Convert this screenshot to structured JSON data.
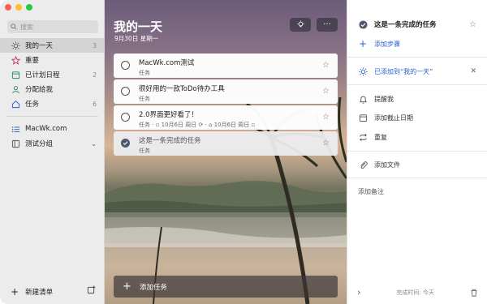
{
  "sidebar": {
    "search_placeholder": "搜索",
    "items": [
      {
        "label": "我的一天",
        "count": "3",
        "icon": "sun-icon",
        "color": "#555555"
      },
      {
        "label": "重要",
        "count": "",
        "icon": "star-icon",
        "color": "#c23a6b"
      },
      {
        "label": "已计划日程",
        "count": "2",
        "icon": "calendar-icon",
        "color": "#1f8a5a"
      },
      {
        "label": "分配给我",
        "count": "",
        "icon": "person-icon",
        "color": "#1f8a5a"
      },
      {
        "label": "任务",
        "count": "6",
        "icon": "home-icon",
        "color": "#2b5fc9"
      }
    ],
    "lists": [
      {
        "label": "MacWk.com",
        "icon": "list-icon"
      },
      {
        "label": "测试分组",
        "icon": "group-icon"
      }
    ],
    "new_list": "新建清单"
  },
  "main": {
    "title": "我的一天",
    "date": "9月30日 星期一",
    "tasks": [
      {
        "title": "MacWk.com测试",
        "sub": "任务",
        "done": false
      },
      {
        "title": "很好用的一款ToDo待办工具",
        "sub": "任务",
        "done": false
      },
      {
        "title": "2.0界面更好看了！",
        "sub": "任务 · ▫ 10月6日 周日 ⟳ · ⌂ 10月6日 周日 ▫",
        "done": false
      },
      {
        "title": "这是一条完成的任务",
        "sub": "任务",
        "done": true
      }
    ],
    "add_task": "添加任务"
  },
  "detail": {
    "task_title": "这是一条完成的任务",
    "add_step": "添加步骤",
    "added_my_day": "已添加到“我的一天”",
    "remind_me": "提醒我",
    "add_due": "添加截止日期",
    "repeat": "重复",
    "add_file": "添加文件",
    "add_note": "添加备注",
    "completed_time": "完成时间: 今天"
  },
  "colors": {
    "accent": "#2b5fc9",
    "sidebar_bg": "#ececec"
  }
}
